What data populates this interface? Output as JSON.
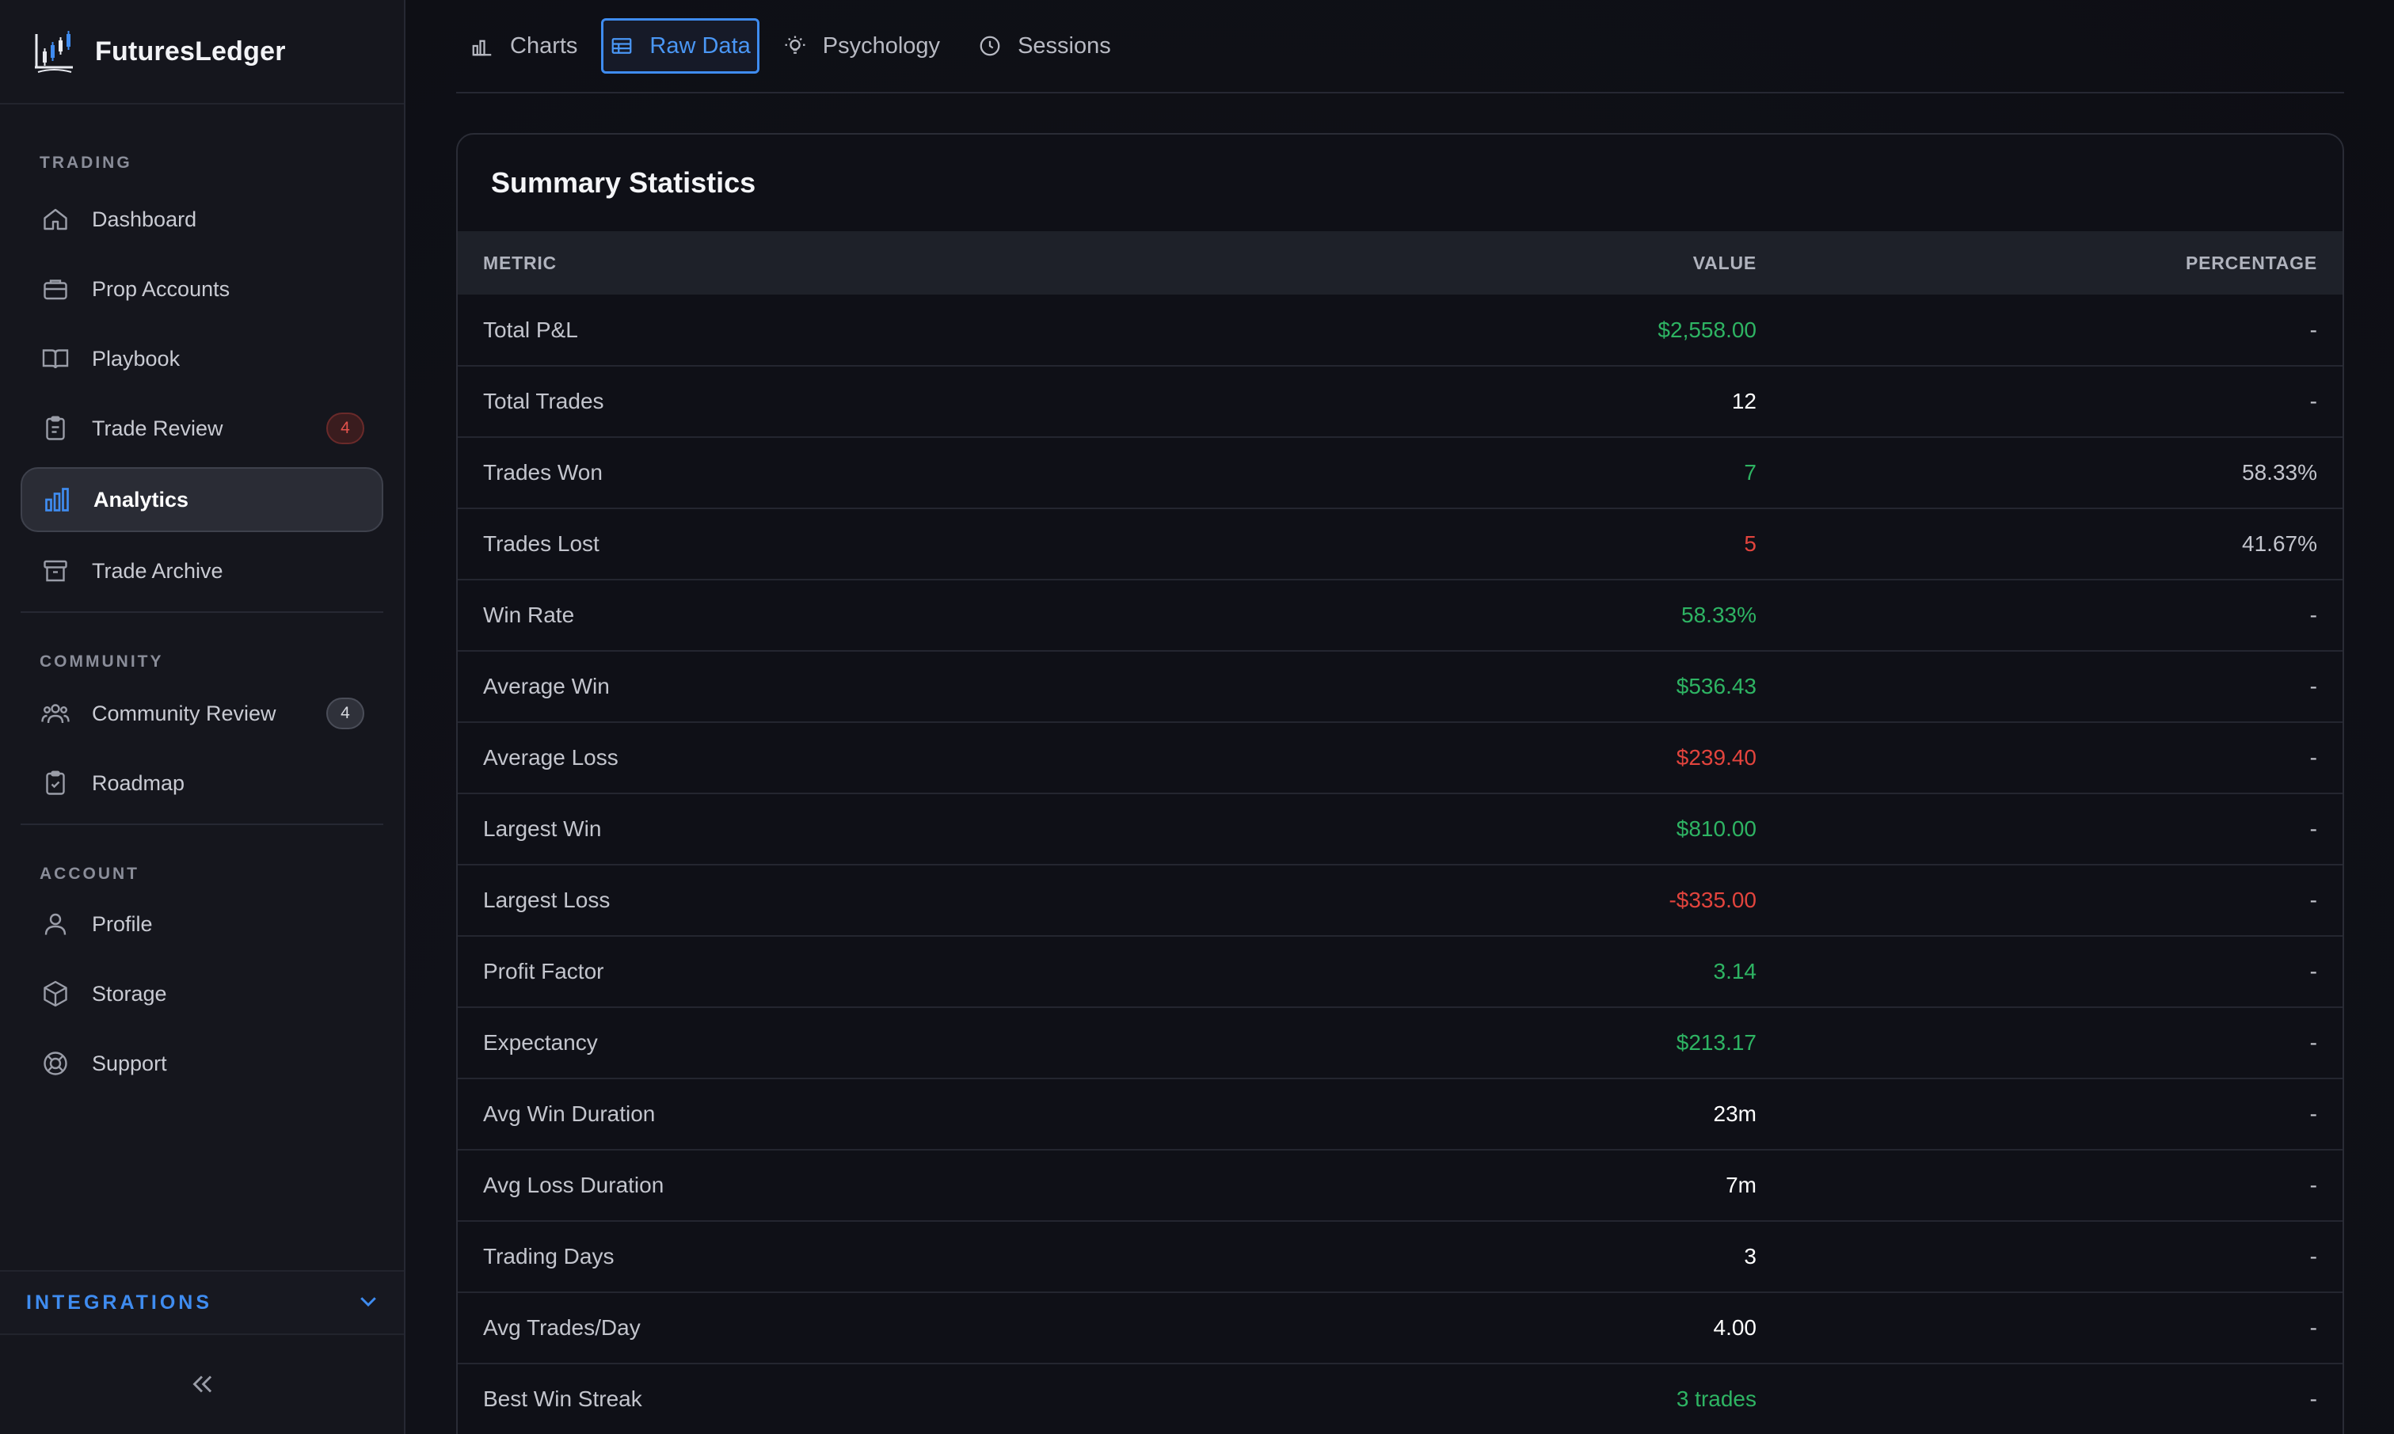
{
  "app": {
    "name": "FuturesLedger"
  },
  "sidebar": {
    "sections": [
      {
        "label": "TRADING",
        "items": [
          {
            "label": "Dashboard",
            "icon": "home-icon"
          },
          {
            "label": "Prop Accounts",
            "icon": "briefcase-icon"
          },
          {
            "label": "Playbook",
            "icon": "book-icon"
          },
          {
            "label": "Trade Review",
            "icon": "clipboard-icon",
            "badge": "4"
          },
          {
            "label": "Analytics",
            "icon": "bar-chart-icon",
            "active": true
          },
          {
            "label": "Trade Archive",
            "icon": "archive-icon"
          }
        ]
      },
      {
        "label": "COMMUNITY",
        "items": [
          {
            "label": "Community Review",
            "icon": "users-icon",
            "badge": "4"
          },
          {
            "label": "Roadmap",
            "icon": "clipboard-check-icon"
          }
        ]
      },
      {
        "label": "ACCOUNT",
        "items": [
          {
            "label": "Profile",
            "icon": "user-icon"
          },
          {
            "label": "Storage",
            "icon": "box-icon"
          },
          {
            "label": "Support",
            "icon": "life-buoy-icon"
          }
        ]
      }
    ],
    "integrations_label": "INTEGRATIONS"
  },
  "tabs": [
    {
      "label": "Charts",
      "icon": "bar-chart-icon"
    },
    {
      "label": "Raw Data",
      "icon": "table-icon",
      "active": true
    },
    {
      "label": "Psychology",
      "icon": "lightbulb-icon"
    },
    {
      "label": "Sessions",
      "icon": "clock-icon"
    }
  ],
  "summary": {
    "title": "Summary Statistics",
    "columns": {
      "metric": "Metric",
      "value": "Value",
      "percentage": "Percentage"
    },
    "rows": [
      {
        "metric": "Total P&L",
        "value": "$2,558.00",
        "percentage": "-",
        "tone": "pos"
      },
      {
        "metric": "Total Trades",
        "value": "12",
        "percentage": "-",
        "tone": "neu"
      },
      {
        "metric": "Trades Won",
        "value": "7",
        "percentage": "58.33%",
        "tone": "pos"
      },
      {
        "metric": "Trades Lost",
        "value": "5",
        "percentage": "41.67%",
        "tone": "neg"
      },
      {
        "metric": "Win Rate",
        "value": "58.33%",
        "percentage": "-",
        "tone": "pos"
      },
      {
        "metric": "Average Win",
        "value": "$536.43",
        "percentage": "-",
        "tone": "pos"
      },
      {
        "metric": "Average Loss",
        "value": "$239.40",
        "percentage": "-",
        "tone": "neg"
      },
      {
        "metric": "Largest Win",
        "value": "$810.00",
        "percentage": "-",
        "tone": "pos"
      },
      {
        "metric": "Largest Loss",
        "value": "-$335.00",
        "percentage": "-",
        "tone": "neg"
      },
      {
        "metric": "Profit Factor",
        "value": "3.14",
        "percentage": "-",
        "tone": "pos"
      },
      {
        "metric": "Expectancy",
        "value": "$213.17",
        "percentage": "-",
        "tone": "pos"
      },
      {
        "metric": "Avg Win Duration",
        "value": "23m",
        "percentage": "-",
        "tone": "neu"
      },
      {
        "metric": "Avg Loss Duration",
        "value": "7m",
        "percentage": "-",
        "tone": "neu"
      },
      {
        "metric": "Trading Days",
        "value": "3",
        "percentage": "-",
        "tone": "neu"
      },
      {
        "metric": "Avg Trades/Day",
        "value": "4.00",
        "percentage": "-",
        "tone": "neu"
      },
      {
        "metric": "Best Win Streak",
        "value": "3 trades",
        "percentage": "-",
        "tone": "pos"
      }
    ]
  },
  "colors": {
    "accent": "#3f8cf0",
    "positive": "#2eb463",
    "negative": "#e2443d"
  }
}
